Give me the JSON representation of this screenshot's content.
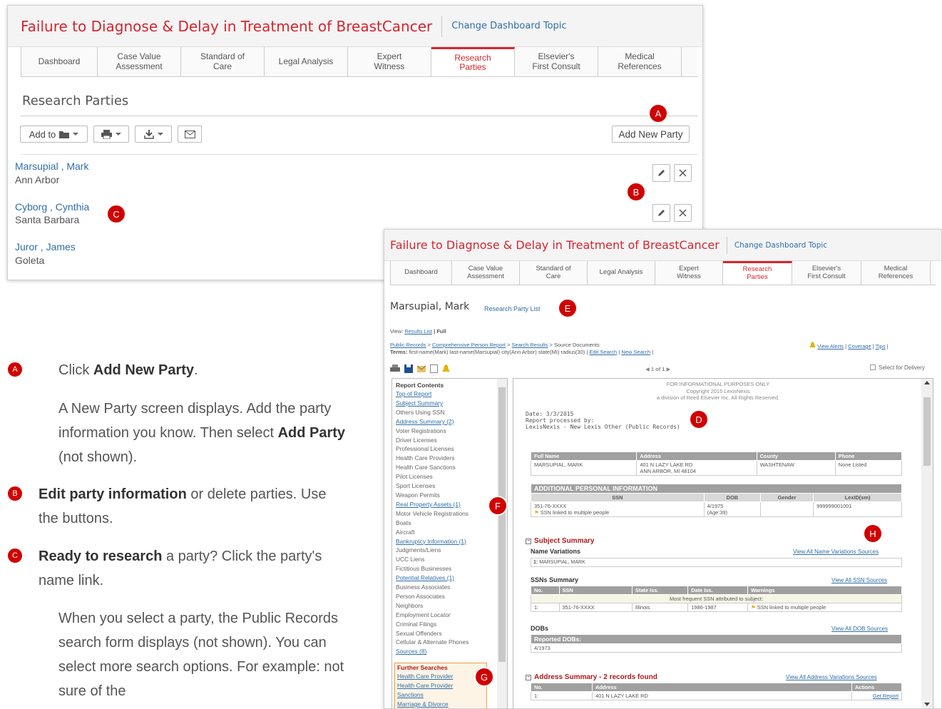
{
  "panel1": {
    "title": "Failure to Diagnose & Delay in Treatment of BreastCancer",
    "change_topic": "Change Dashboard Topic",
    "tabs": [
      {
        "label": "Dashboard"
      },
      {
        "label": "Case Value\nAssessment"
      },
      {
        "label": "Standard of\nCare"
      },
      {
        "label": "Legal Analysis"
      },
      {
        "label": "Expert\nWitness"
      },
      {
        "label": "Research\nParties"
      },
      {
        "label": "Elsevier's\nFirst Consult"
      },
      {
        "label": "Medical\nReferences"
      }
    ],
    "active_tab": "Research Parties",
    "page_heading": "Research Parties",
    "toolbar": {
      "add_to": "Add to",
      "add_new_party": "Add New Party"
    },
    "parties": [
      {
        "name": "Marsupial , Mark",
        "city": "Ann Arbor"
      },
      {
        "name": "Cyborg , Cynthia",
        "city": "Santa Barbara"
      },
      {
        "name": "Juror , James",
        "city": "Goleta"
      }
    ]
  },
  "markers": {
    "a": "A",
    "b": "B",
    "c": "C",
    "d": "D",
    "e": "E",
    "f": "F",
    "g": "G",
    "h": "H"
  },
  "instructions": {
    "a_pre": "Click ",
    "a_bold": "Add New Party",
    "a_post": ".",
    "a_p1": "A New Party screen displays. Add  the party information you know. Then select ",
    "a_p1_bold": "Add Party",
    "a_p1_post": " (not shown).",
    "b_bold": "Edit party information",
    "b_post": " or delete parties. Use the buttons.",
    "c_bold": "Ready to research",
    "c_post": " a party? Click the party's name link.",
    "c_p1": "When you select a party, the Public Records search form displays (not shown). You can select more search options. For example: not sure of the"
  },
  "panel2": {
    "title": "Failure to Diagnose & Delay in Treatment of BreastCancer",
    "change_topic": "Change Dashboard Topic",
    "party_name": "Marsupial, Mark",
    "research_party_list": "Research Party List",
    "view_label": "View:",
    "view_results": "Results List",
    "view_full": " | Full",
    "bc1": "Public Records",
    "bc2": "Comprehensive Person Report",
    "bc3": "Search Results",
    "bc4": "Source Documents",
    "terms_label": "Terms:",
    "terms_text": "first-name(Mark) last-name(Marsupial) city(Ann Arbor) state(MI) radius(30)",
    "edit_search": "Edit Search",
    "new_search": "New Search",
    "view_alerts": "View Alerts",
    "coverage": "Coverage",
    "tips": "Tips",
    "pager": "1 of 1",
    "select_delivery": "Select for Delivery",
    "sidebar": {
      "report_contents": "Report Contents",
      "items": [
        {
          "label": "Top of Report",
          "link": true
        },
        {
          "label": "Subject Summary",
          "link": true
        },
        {
          "label": "Others Using SSN",
          "link": false
        },
        {
          "label": "Address Summary (2)",
          "link": true
        },
        {
          "label": "Voter Registrations",
          "link": false
        },
        {
          "label": "Driver Licenses",
          "link": false
        },
        {
          "label": "Professional Licenses",
          "link": false
        },
        {
          "label": "Health Care Providers",
          "link": false
        },
        {
          "label": "Health Care Sanctions",
          "link": false
        },
        {
          "label": "Pilot Licenses",
          "link": false
        },
        {
          "label": "Sport Licenses",
          "link": false
        },
        {
          "label": "Weapon Permits",
          "link": false
        },
        {
          "label": "Real Property Assets (1)",
          "link": true
        },
        {
          "label": "Motor Vehicle Registrations",
          "link": false
        },
        {
          "label": "Boats",
          "link": false
        },
        {
          "label": "Aircraft",
          "link": false
        },
        {
          "label": "Bankruptcy Information (1)",
          "link": true
        },
        {
          "label": "Judgments/Liens",
          "link": false
        },
        {
          "label": "UCC Liens",
          "link": false
        },
        {
          "label": "Fictitious Businesses",
          "link": false
        },
        {
          "label": "Potential Relatives (1)",
          "link": true
        },
        {
          "label": "Business Associates",
          "link": false
        },
        {
          "label": "Person Associates",
          "link": false
        },
        {
          "label": "Neighbors",
          "link": false
        },
        {
          "label": "Employment Locator",
          "link": false
        },
        {
          "label": "Criminal Filings",
          "link": false
        },
        {
          "label": "Sexual Offenders",
          "link": false
        },
        {
          "label": "Cellular & Alternate Phones",
          "link": false
        },
        {
          "label": "Sources (8)",
          "link": true
        }
      ],
      "further_searches": "Further Searches",
      "further_items": [
        "Health Care Provider",
        "Health Care Provider",
        "Sanctions",
        "Marriage & Divorce"
      ]
    },
    "doc": {
      "info1": "FOR INFORMATIONAL PURPOSES ONLY",
      "info2": "Copyright 2015 LexisNexis",
      "info3": "a division of Reed Elsevier Inc. All Rights Reserved.",
      "date": "Date: 3/3/2015",
      "processed": "Report processed by:",
      "processor": "LexisNexis - New Lexis Other (Public Records)",
      "t1_headers": [
        "Full Name",
        "Address",
        "County",
        "Phone"
      ],
      "t1_row": {
        "name": "MARSUPIAL, MARK",
        "addr1": "401 N LAZY LAKE RD",
        "addr2": "ANN ARBOR, MI 48104",
        "county": "WASHTENAW",
        "phone": "None Listed"
      },
      "additional": "ADDITIONAL PERSONAL INFORMATION",
      "t2_headers": [
        "SSN",
        "DOB",
        "Gender",
        "LexID(sm)"
      ],
      "t2_row": {
        "ssn": "351-76-XXXX",
        "ssn_note": "SSN linked to multiple people",
        "dob": "4/1975",
        "age": "(Age:39)",
        "gender": "",
        "lexid": "999999001001"
      },
      "subject_summary": "Subject Summary",
      "name_variations": "Name Variations",
      "view_names": "View All Name Variations Sources",
      "name_row_num": "1:",
      "name_row": "MARSUPIAL, MARK",
      "ssns_summary": "SSNs Summary",
      "view_ssn": "View All SSN Sources",
      "t3_headers": [
        "No.",
        "SSN",
        "State Iss.",
        "Date Iss.",
        "Warnings"
      ],
      "t3_note": "Most frequent SSN attributed to subject:",
      "t3_row": {
        "no": "1:",
        "ssn": "351-76-XXXX",
        "state": "Illinois",
        "date": "1986-1987",
        "warn": "SSN linked to multiple people"
      },
      "dobs": "DOBs",
      "view_dob": "View All DOB Sources",
      "reported_dobs": "Reported DOBs:",
      "dob_val": "4/1973",
      "address_summary": "Address Summary - 2 records found",
      "view_addr": "View All Address Variations Sources",
      "t4_headers": [
        "No.",
        "Address",
        "Actions"
      ],
      "t4_row": {
        "no": "1:",
        "addr": "401 N LAZY LAKE RD",
        "action": "Get Report"
      }
    }
  }
}
